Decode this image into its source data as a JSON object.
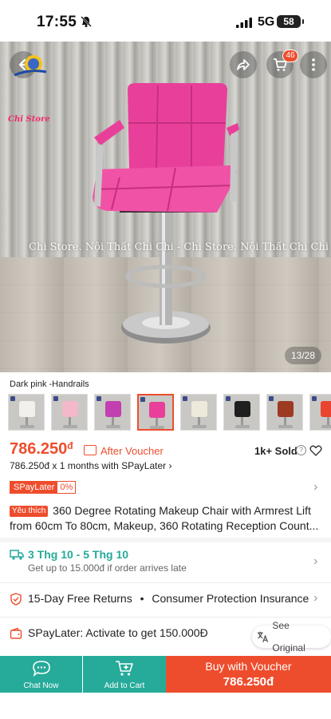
{
  "status_bar": {
    "time": "17:55",
    "network": "5G",
    "battery": "58"
  },
  "hero": {
    "logo_text": "Chi Store",
    "watermark": "Chi Store. Nội Thất Chi Chi - Chi Store. Nội Thất Chi Chi",
    "cart_count": "46",
    "image_counter": "13/28",
    "icons": [
      "back-arrow-icon",
      "share-icon",
      "cart-icon",
      "more-icon"
    ]
  },
  "variants": {
    "label": "Dark pink -Handrails",
    "colors": [
      "#f2f0ea",
      "#f3b8c9",
      "#c23fb0",
      "#e8409a",
      "#efe9db",
      "#1f1f1f",
      "#9c3a22",
      "#e8442f"
    ],
    "selected_index": 3
  },
  "price": {
    "amount": "786.250",
    "currency": "đ",
    "voucher_note": "After Voucher",
    "sold": "1k+ Sold",
    "installment": "786.250đ x 1 months with SPayLater",
    "spay_badge": "SPayLater",
    "spay_rate": "0%"
  },
  "product": {
    "badge": "Yêu thích",
    "title": "360 Degree Rotating Makeup Chair with Armrest Lift from 60cm To 80cm, Makeup, 360 Rotating Reception Count..."
  },
  "shipping": {
    "dates": "3 Thg 10 - 5 Thg 10",
    "note": "Get up to 15.000đ if order arrives late"
  },
  "returns": {
    "text": "15-Day Free Returns",
    "separator": "•",
    "insurance": "Consumer Protection Insurance"
  },
  "spaylater_row": {
    "text": "SPayLater: Activate to get 150.000Đ"
  },
  "see_original": "See Original",
  "bottom_bar": {
    "chat": "Chat Now",
    "add_to_cart": "Add to Cart",
    "buy_line1": "Buy with Voucher",
    "buy_line2": "786.250đ"
  },
  "colors": {
    "accent": "#ee4d2d",
    "teal": "#26aa99",
    "chair": "#e8409a"
  }
}
